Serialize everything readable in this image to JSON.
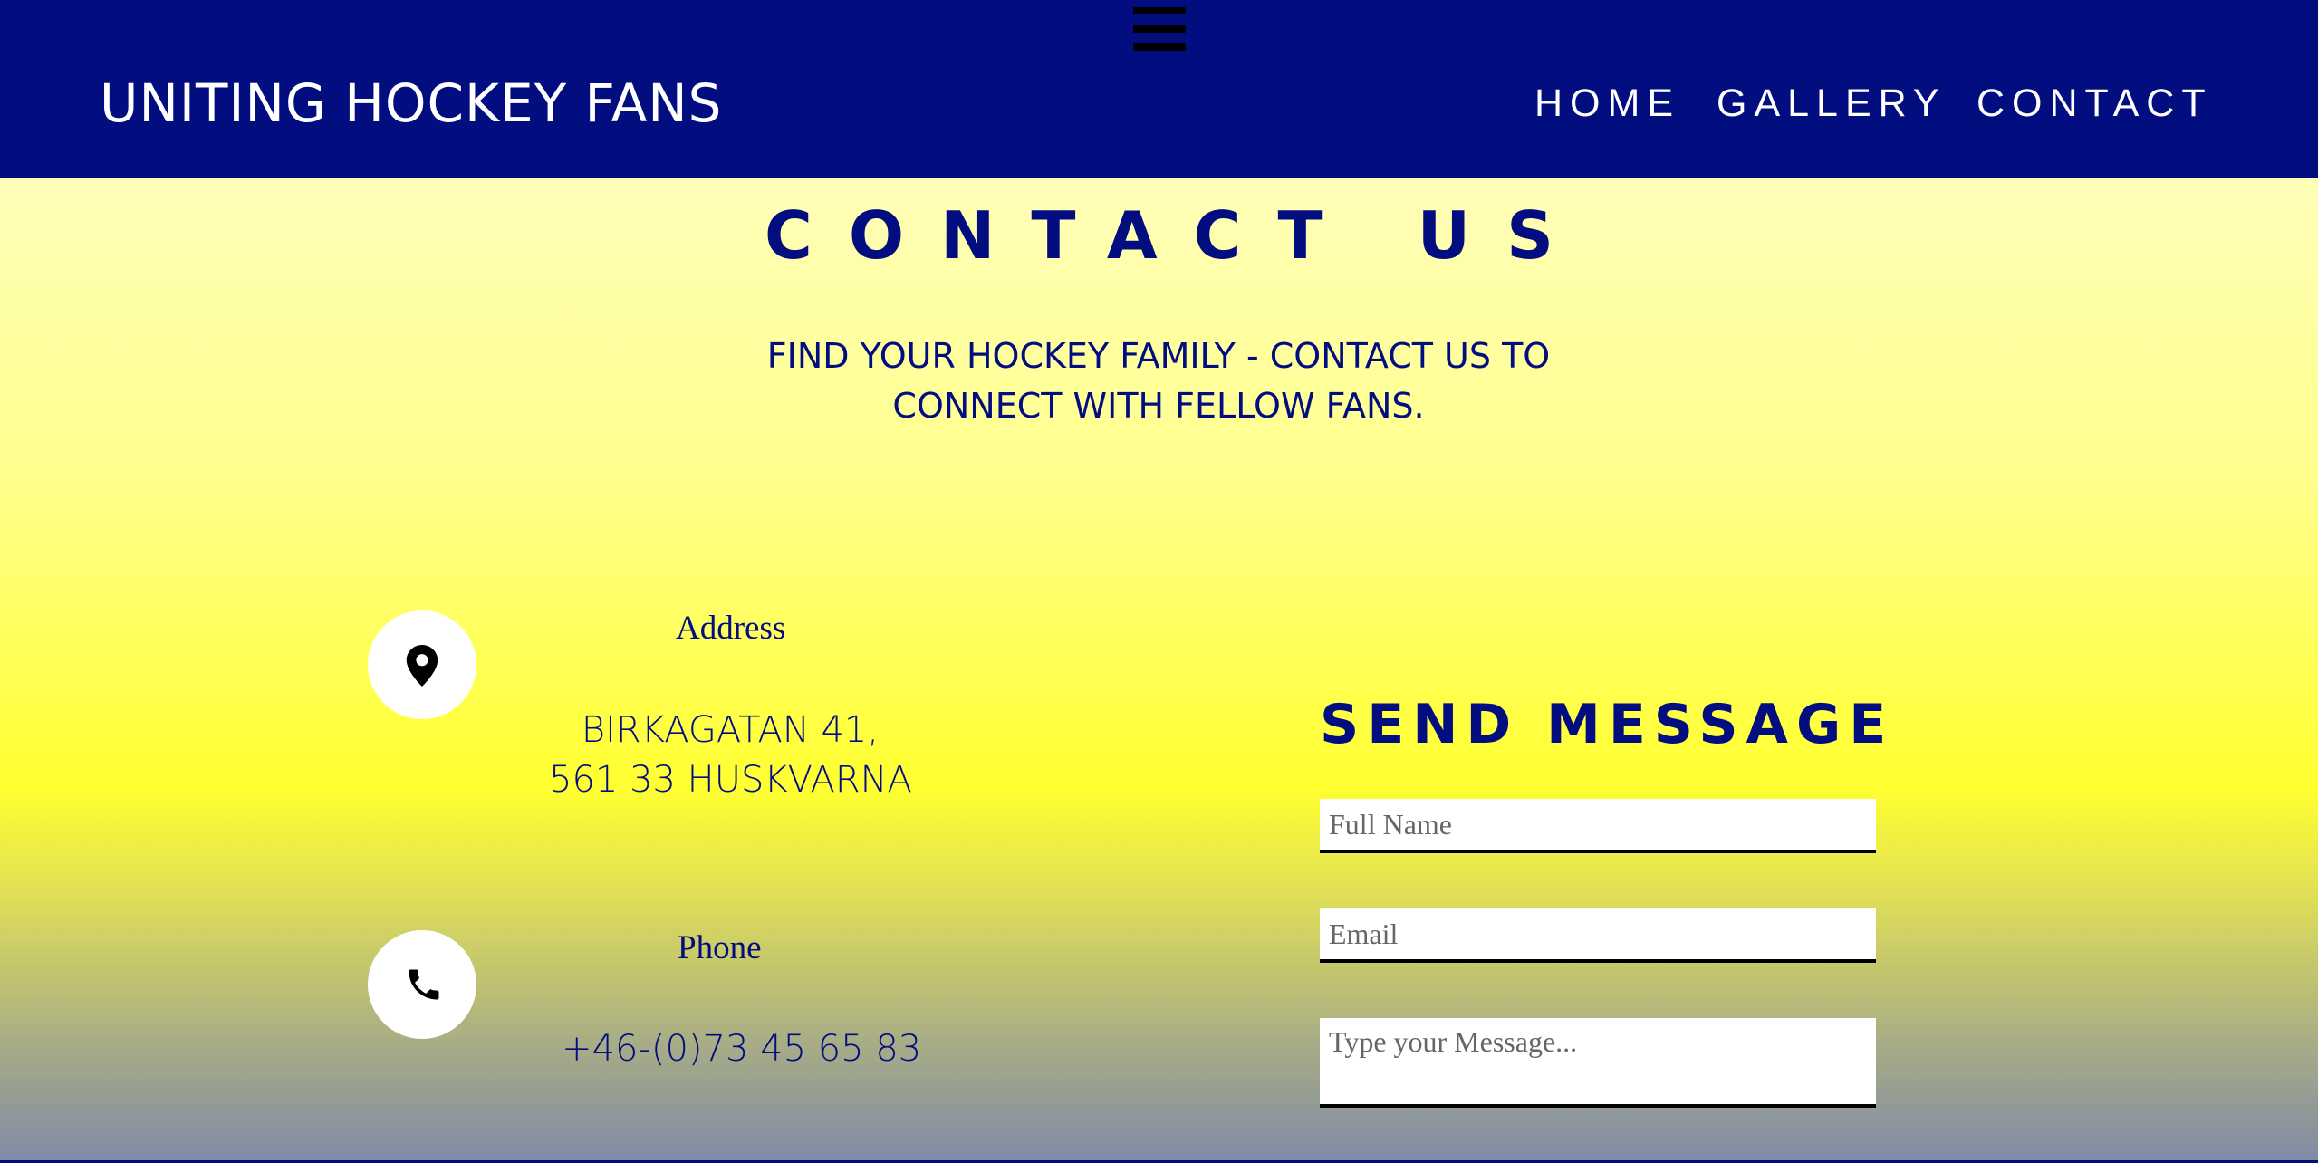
{
  "header": {
    "brand": "UNITING HOCKEY FANS",
    "nav": [
      "HOME",
      "GALLERY",
      "CONTACT"
    ],
    "background_color": "#020d80"
  },
  "hero": {
    "title": "CONTACT US",
    "subtitle_line1": "FIND YOUR HOCKEY FAMILY - CONTACT US TO",
    "subtitle_line2": "CONNECT WITH FELLOW FANS."
  },
  "contact_info": {
    "address": {
      "icon": "map-pin-icon",
      "label": "Address",
      "line1": "BIRKAGATAN 41,",
      "line2": "561 33 HUSKVARNA"
    },
    "phone": {
      "icon": "phone-icon",
      "label": "Phone",
      "value": "+46-(0)73 45 65 83"
    }
  },
  "form": {
    "title": "SEND MESSAGE",
    "full_name_placeholder": "Full Name",
    "email_placeholder": "Email",
    "message_placeholder": "Type your Message..."
  },
  "colors": {
    "accent": "#020d80",
    "gradient_top": "#fffed2",
    "gradient_mid": "#ffff30",
    "gradient_bottom": "#7f8aa6"
  }
}
